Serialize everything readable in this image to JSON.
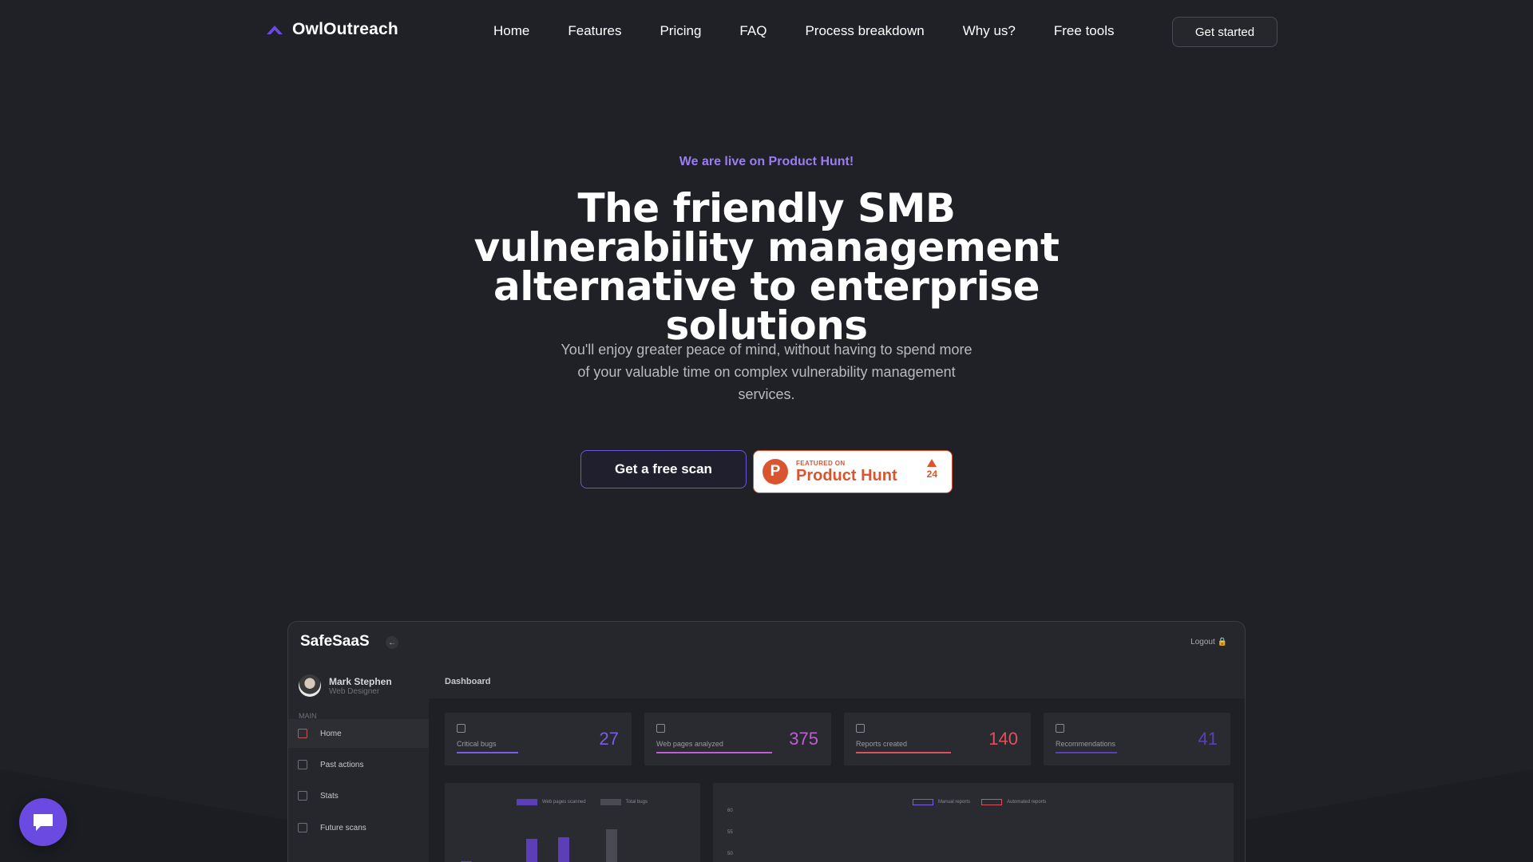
{
  "nav": {
    "brand": "OwlOutreach",
    "links": [
      "Home",
      "Features",
      "Pricing",
      "FAQ",
      "Process breakdown",
      "Why us?",
      "Free tools"
    ],
    "cta": "Get started",
    "accent": "#6a4ae0"
  },
  "hero": {
    "kicker": "We are live on Product Hunt!",
    "title": "The friendly SMB vulnerability management alternative to enterprise solutions",
    "subtitle": "You'll enjoy greater peace of mind, without having to spend more of your valuable time on complex vulnerability management services.",
    "primary_button": "Get a free scan",
    "product_hunt": {
      "featured": "FEATURED ON",
      "name": "Product Hunt",
      "letter": "P",
      "upvotes": "24"
    }
  },
  "dashboard": {
    "brand": "SafeSaaS",
    "logout": "Logout",
    "user": {
      "name": "Mark Stephen",
      "role": "Web Designer"
    },
    "section": "MAIN",
    "nav": [
      "Home",
      "Past actions",
      "Stats",
      "Future scans"
    ],
    "page_title": "Dashboard",
    "stats": [
      {
        "label": "Critical bugs",
        "value": "27",
        "color": "#7b5ce6",
        "fill": 0.45
      },
      {
        "label": "Web pages analyzed",
        "value": "375",
        "color": "#c15cd6",
        "fill": 0.85
      },
      {
        "label": "Reports created",
        "value": "140",
        "color": "#e0505b",
        "fill": 0.7
      },
      {
        "label": "Recommendations",
        "value": "41",
        "color": "#5c3fb8",
        "fill": 0.45
      }
    ],
    "bar_legend": [
      "Web pages scanned",
      "Total bugs"
    ],
    "line_legend": [
      "Manual reports",
      "Automated reports"
    ],
    "line_yticks": [
      "60",
      "55",
      "50"
    ]
  },
  "chat": {
    "icon": "chat-bubble-icon"
  }
}
